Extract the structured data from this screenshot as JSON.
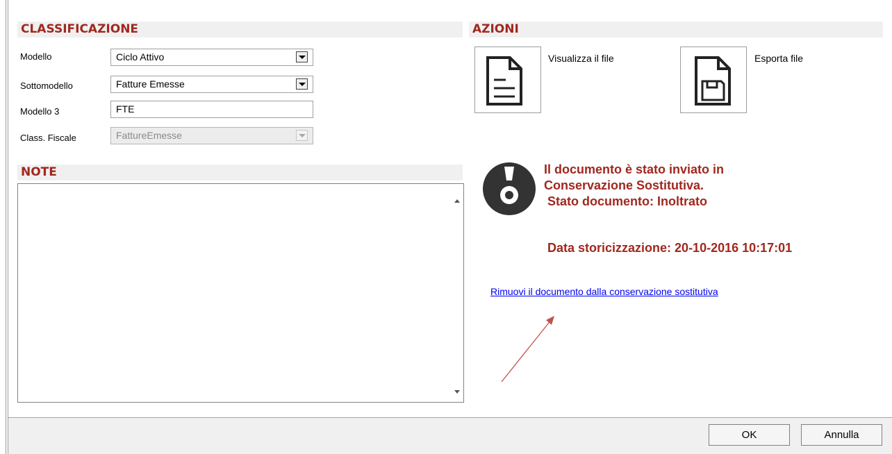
{
  "classificazione": {
    "title": "CLASSIFICAZIONE",
    "fields": [
      {
        "label": "Modello",
        "value": "Ciclo Attivo"
      },
      {
        "label": "Sottomodello",
        "value": "Fatture Emesse"
      },
      {
        "label": "Modello 3",
        "value": "FTE"
      },
      {
        "label": "Class. Fiscale",
        "value": "FattureEmesse"
      }
    ]
  },
  "note": {
    "title": "NOTE",
    "value": ""
  },
  "azioni": {
    "title": "AZIONI",
    "view_label": "Visualizza il file",
    "export_label": "Esporta file"
  },
  "status": {
    "line1": "Il documento è stato inviato in",
    "line2": "Conservazione Sostitutiva.",
    "line3": "Stato documento: Inoltrato",
    "date": "Data storicizzazione: 20-10-2016 10:17:01",
    "remove_link": "Rimuovi il documento dalla conservazione sostitutiva"
  },
  "buttons": {
    "ok": "OK",
    "annulla": "Annulla"
  },
  "colors": {
    "accent": "#a0281e",
    "link": "#0000ee",
    "arrow": "#c0504d"
  }
}
